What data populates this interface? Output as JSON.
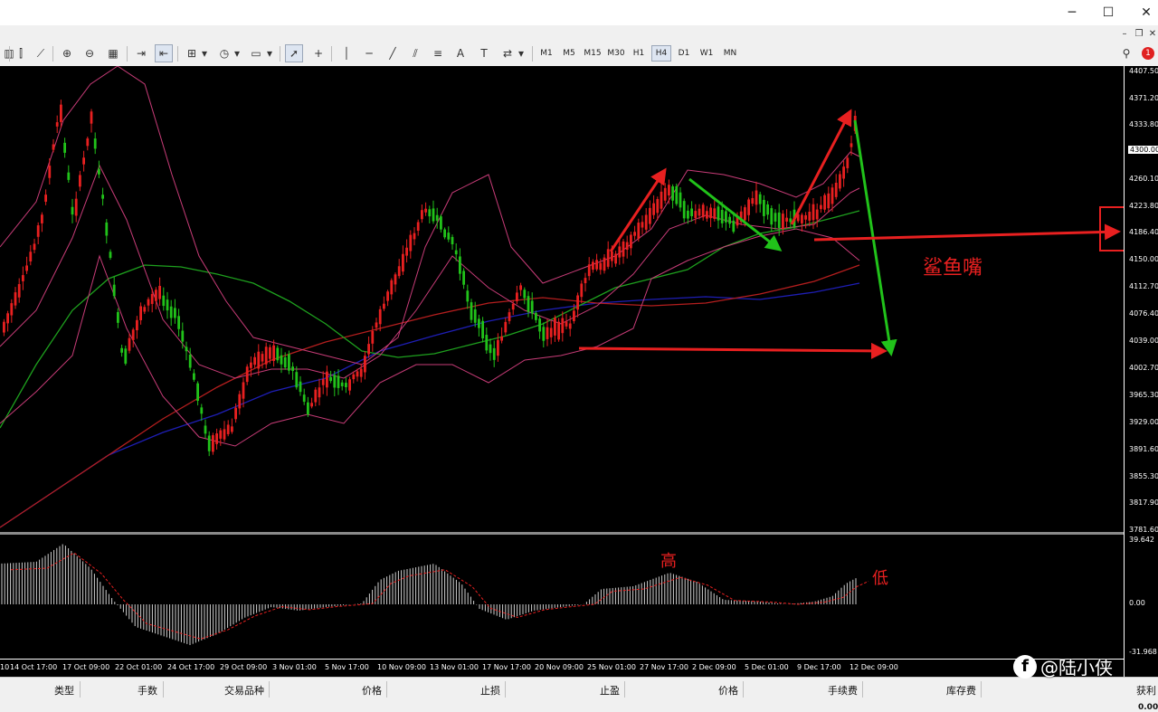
{
  "toolbar": {
    "timeframes": [
      "M1",
      "M5",
      "M15",
      "M30",
      "H1",
      "H4",
      "D1",
      "W1",
      "MN"
    ],
    "active_timeframe": "H4"
  },
  "chart": {
    "price_labels": [
      "4407.50",
      "4371.20",
      "4333.80",
      "4300.00",
      "4260.10",
      "4223.80",
      "4186.40",
      "4150.00",
      "4112.70",
      "4076.40",
      "4039.00",
      "4002.70",
      "3965.30",
      "3929.00",
      "3891.60",
      "3855.30",
      "3817.90",
      "3781.60"
    ],
    "current_price_label": "4300.00",
    "time_labels": [
      "10",
      "14 Oct 17:00",
      "17 Oct 09:00",
      "22 Oct 01:00",
      "24 Oct 17:00",
      "29 Oct 09:00",
      "3 Nov 01:00",
      "5 Nov 17:00",
      "10 Nov 09:00",
      "13 Nov 01:00",
      "17 Nov 17:00",
      "20 Nov 09:00",
      "25 Nov 01:00",
      "27 Nov 17:00",
      "2 Dec 09:00",
      "5 Dec 01:00",
      "9 Dec 17:00",
      "12 Dec 09:00"
    ],
    "indicator_labels": [
      "39.642",
      "0.00",
      "-31.968"
    ],
    "annotations": {
      "shark": "鲨鱼嘴",
      "high": "高",
      "low": "低"
    },
    "colors": {
      "bull": "#e82020",
      "bear": "#21c21a",
      "ma_slow": "#1e1eb4",
      "ma_mid": "#b41e1e",
      "ma_green": "#1ea01e",
      "bands": "#c83c78"
    }
  },
  "terminal": {
    "columns": [
      "类型",
      "手数",
      "交易品种",
      "价格",
      "止损",
      "止盈",
      "价格",
      "手续费",
      "库存费",
      "获利"
    ],
    "profit_value": "0.00"
  },
  "watermark": {
    "icon": "f",
    "text": "@陆小侠"
  }
}
